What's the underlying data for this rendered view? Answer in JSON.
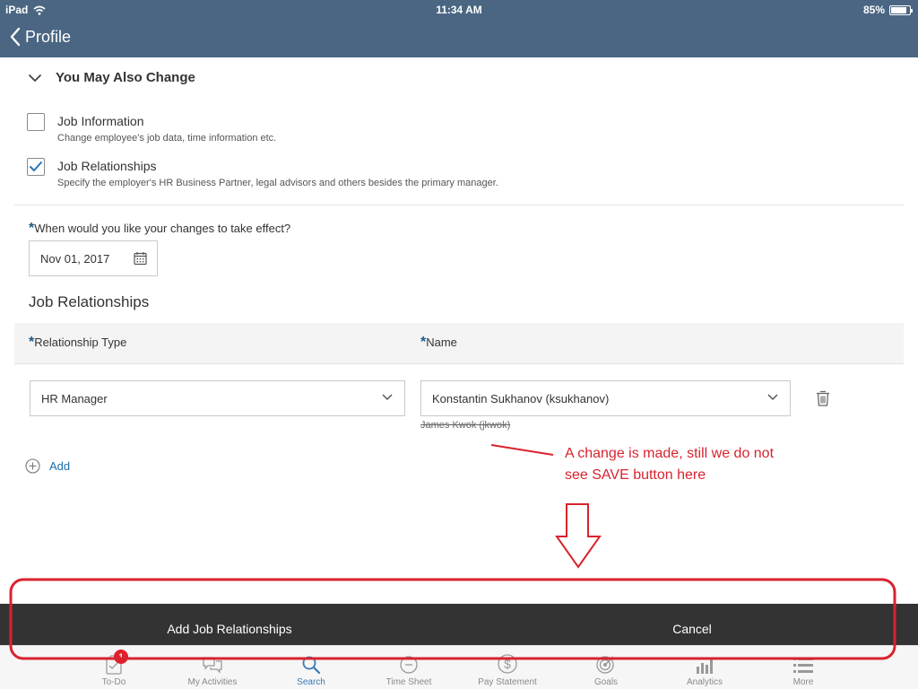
{
  "status_bar": {
    "device": "iPad",
    "time": "11:34 AM",
    "battery": "85%",
    "battery_level": 0.85
  },
  "header": {
    "back_label": "Profile"
  },
  "section": {
    "title": "You May Also Change",
    "options": [
      {
        "title": "Job Information",
        "desc": "Change employee's job data, time information etc.",
        "checked": false
      },
      {
        "title": "Job Relationships",
        "desc": "Specify the employer's HR Business Partner, legal advisors and others besides the primary manager.",
        "checked": true
      }
    ]
  },
  "effective": {
    "required_mark": "*",
    "label": "When would you like your changes to take effect?",
    "date": "Nov 01, 2017"
  },
  "job_relationships": {
    "heading": "Job Relationships",
    "col_type": "Relationship Type",
    "col_name": "Name",
    "row": {
      "type": "HR Manager",
      "name": "Konstantin Sukhanov (ksukhanov)",
      "previous_name": "James Kwok (jkwok)"
    },
    "add_label": "Add"
  },
  "annotation": {
    "text": "A change is made, still we do not see SAVE button here",
    "color": "#d9232e"
  },
  "action_bar": {
    "primary_label": "Add Job Relationships",
    "cancel_label": "Cancel"
  },
  "tabs": [
    {
      "label": "To-Do",
      "icon": "todo-icon",
      "badge": "1"
    },
    {
      "label": "My Activities",
      "icon": "chat-icon"
    },
    {
      "label": "Search",
      "icon": "search-icon",
      "active": true
    },
    {
      "label": "Time Sheet",
      "icon": "clock-icon"
    },
    {
      "label": "Pay Statement",
      "icon": "dollar-icon"
    },
    {
      "label": "Goals",
      "icon": "target-icon"
    },
    {
      "label": "Analytics",
      "icon": "bar-chart-icon"
    },
    {
      "label": "More",
      "icon": "list-icon"
    }
  ],
  "colors": {
    "header": "#4a6682",
    "accent": "#1d6fa5",
    "action_bar": "#333333",
    "annotation": "#d9232e"
  }
}
